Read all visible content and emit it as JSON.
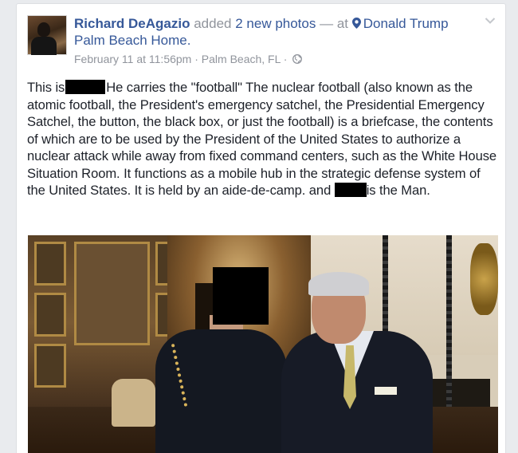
{
  "post": {
    "author": "Richard DeAgazio",
    "action_prefix": "added",
    "action_link": "2 new photos",
    "separator": "— at",
    "place": "Donald Trump Palm Beach Home.",
    "timestamp": "February 11 at 11:56pm",
    "meta_separator": "·",
    "location": "Palm Beach, FL",
    "meta_separator_2": "·",
    "text": {
      "part1": "This is",
      "part2": "He carries the \"football\" The nuclear football (also known as the atomic football, the President's emergency satchel, the Presidential Emergency Satchel, the button, the black box, or just the football) is a briefcase, the contents of which are to be used by the President of the United States to authorize a nuclear attack while away from fixed command centers, such as the White House Situation Room. It functions as a mobile hub in the strategic defense system of the United States. It is held by an aide-de-camp. and",
      "part3": "is the Man."
    }
  },
  "icons": {
    "place_pin": "location-pin-icon",
    "privacy": "globe-icon",
    "menu": "chevron-down-icon"
  },
  "colors": {
    "link": "#365899",
    "meta": "#90949c",
    "text": "#1d2129",
    "background": "#e9ebee"
  }
}
